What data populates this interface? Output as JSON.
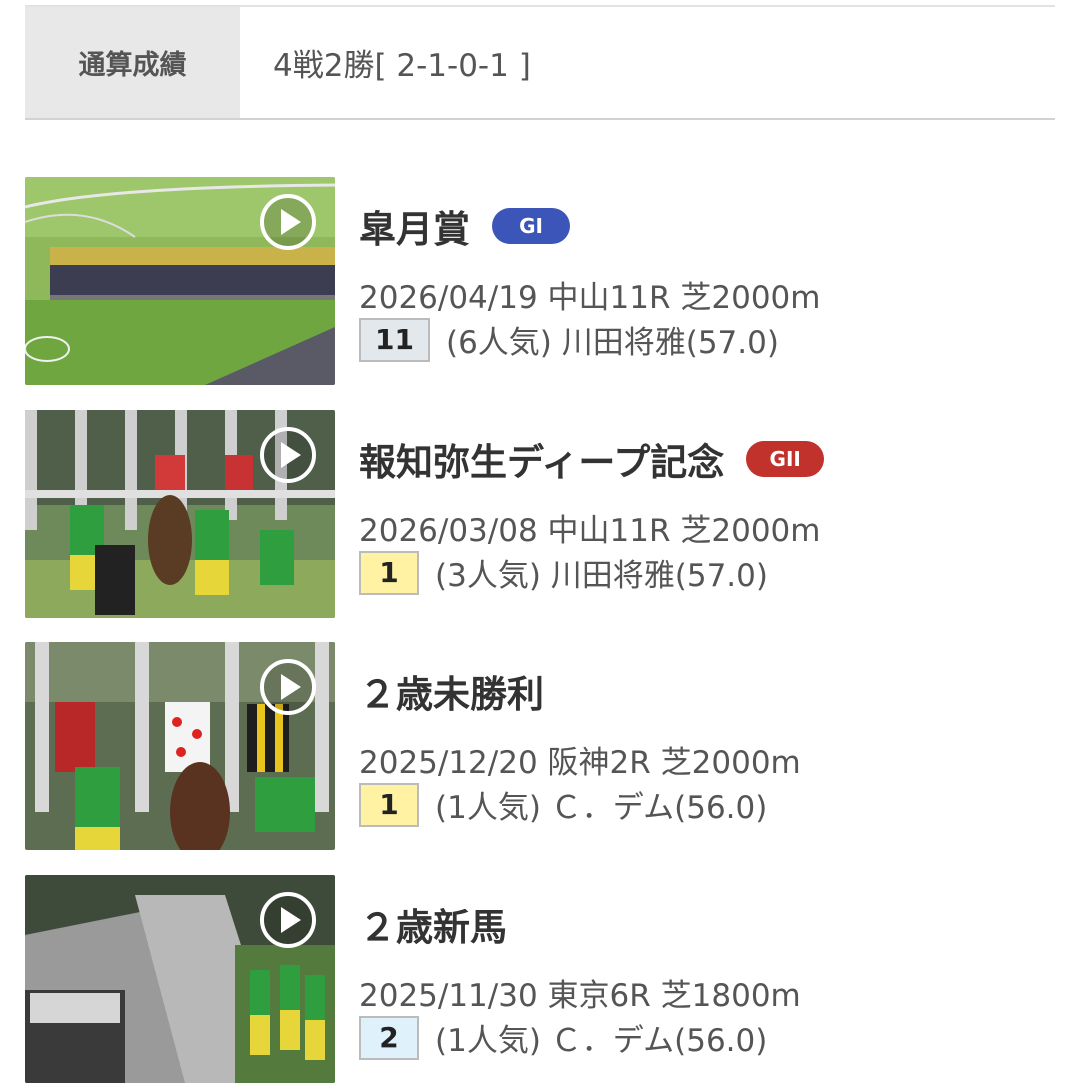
{
  "summary": {
    "label": "通算成績",
    "value": "4戦2勝[ 2-1-0-1 ]"
  },
  "races": [
    {
      "name": "皐月賞",
      "grade": "GI",
      "grade_color": "#3b55b9",
      "meta": "2026/04/19 中山11R 芝2000m",
      "rank": "11",
      "rank_bg": "#e3e8ed",
      "result": "(6人気) 川田将雅(57.0)"
    },
    {
      "name": "報知弥生ディープ記念",
      "grade": "GII",
      "grade_color": "#c0322b",
      "meta": "2026/03/08 中山11R 芝2000m",
      "rank": "1",
      "rank_bg": "#fff3a3",
      "result": "(3人気) 川田将雅(57.0)"
    },
    {
      "name": "２歳未勝利",
      "meta": "2025/12/20 阪神2R 芝2000m",
      "rank": "1",
      "rank_bg": "#fff3a3",
      "result": "(1人気) Ｃ．デム(56.0)"
    },
    {
      "name": "２歳新馬",
      "meta": "2025/11/30 東京6R 芝1800m",
      "rank": "2",
      "rank_bg": "#dff2fb",
      "result": "(1人気) Ｃ．デム(56.0)"
    }
  ]
}
